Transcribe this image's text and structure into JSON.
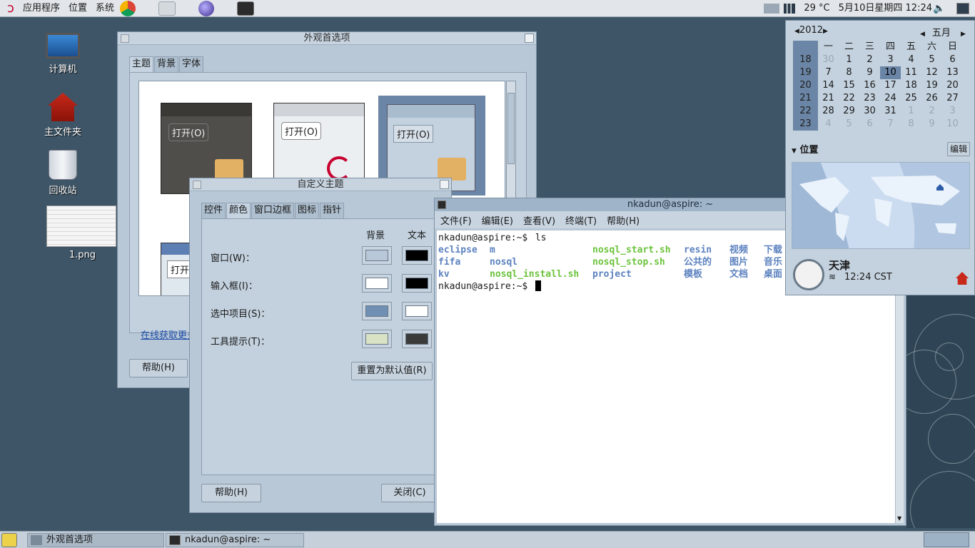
{
  "top_panel": {
    "menus": [
      "应用程序",
      "位置",
      "系统"
    ],
    "launchers": [
      "chrome-icon",
      "network-tool-icon",
      "browser-icon",
      "terminal-icon"
    ],
    "weather": "29 °C",
    "datetime": "5月10日星期四  12:24"
  },
  "desktop": {
    "icons": [
      {
        "name": "computer-icon",
        "label": "计算机"
      },
      {
        "name": "home-folder-icon",
        "label": "主文件夹"
      },
      {
        "name": "trash-icon",
        "label": "回收站"
      },
      {
        "name": "png-file-icon",
        "label": "1.png"
      }
    ]
  },
  "appearance": {
    "title": "外观首选项",
    "tabs": [
      "主题",
      "背景",
      "字体"
    ],
    "active_tab": "主题",
    "theme_open_label": "打开(O)",
    "online_link": "在线获取更多",
    "help_button": "帮助(H)"
  },
  "custom_theme": {
    "title": "自定义主题",
    "tabs": [
      "控件",
      "颜色",
      "窗口边框",
      "图标",
      "指针"
    ],
    "active_tab": "颜色",
    "col_bg": "背景",
    "col_text": "文本",
    "rows": [
      {
        "label": "窗口(W)：",
        "bg": "#b8c8d8",
        "text": "#000000"
      },
      {
        "label": "输入框(I)：",
        "bg": "#ffffff",
        "text": "#000000"
      },
      {
        "label": "选中项目(S)：",
        "bg": "#6f8fb3",
        "text": "#ffffff"
      },
      {
        "label": "工具提示(T)：",
        "bg": "#d9e2c4",
        "text": "#3a3a3a"
      }
    ],
    "reset_button": "重置为默认值(R)",
    "help_button": "帮助(H)",
    "close_button": "关闭(C)"
  },
  "terminal": {
    "title": "nkadun@aspire: ~",
    "menus": [
      "文件(F)",
      "编辑(E)",
      "查看(V)",
      "终端(T)",
      "帮助(H)"
    ],
    "prompt": "nkadun@aspire:~$",
    "command": " ls",
    "ls_rows": [
      [
        {
          "t": "eclipse",
          "c": "blue"
        },
        {
          "t": "m",
          "c": "blue"
        },
        {
          "t": "nosql_start.sh",
          "c": "green"
        },
        {
          "t": "resin",
          "c": "blue"
        },
        {
          "t": "视频",
          "c": "blue"
        },
        {
          "t": "下载",
          "c": "blue"
        }
      ],
      [
        {
          "t": "fifa",
          "c": "blue"
        },
        {
          "t": "nosql",
          "c": "blue"
        },
        {
          "t": "nosql_stop.sh",
          "c": "green"
        },
        {
          "t": "公共的",
          "c": "blue"
        },
        {
          "t": "图片",
          "c": "blue"
        },
        {
          "t": "音乐",
          "c": "blue"
        }
      ],
      [
        {
          "t": "kv",
          "c": "blue"
        },
        {
          "t": "nosql_install.sh",
          "c": "green"
        },
        {
          "t": "project",
          "c": "blue"
        },
        {
          "t": "模板",
          "c": "blue"
        },
        {
          "t": "文档",
          "c": "blue"
        },
        {
          "t": "桌面",
          "c": "blue"
        }
      ]
    ]
  },
  "calendar": {
    "year": "2012",
    "month": "五月",
    "weekday_headers": [
      "一",
      "二",
      "三",
      "四",
      "五",
      "六",
      "日"
    ],
    "weeks": [
      {
        "wk": "18",
        "days": [
          "30",
          "1",
          "2",
          "3",
          "4",
          "5",
          "6"
        ]
      },
      {
        "wk": "19",
        "days": [
          "7",
          "8",
          "9",
          "10",
          "11",
          "12",
          "13"
        ]
      },
      {
        "wk": "20",
        "days": [
          "14",
          "15",
          "16",
          "17",
          "18",
          "19",
          "20"
        ]
      },
      {
        "wk": "21",
        "days": [
          "21",
          "22",
          "23",
          "24",
          "25",
          "26",
          "27"
        ]
      },
      {
        "wk": "22",
        "days": [
          "28",
          "29",
          "30",
          "31",
          "1",
          "2",
          "3"
        ]
      },
      {
        "wk": "23",
        "days": [
          "4",
          "5",
          "6",
          "7",
          "8",
          "9",
          "10"
        ]
      }
    ],
    "today": "10",
    "locations_label": "位置",
    "edit_button": "编辑",
    "city": "天津",
    "city_time": "12:24 CST"
  },
  "taskbar": {
    "tasks": [
      "外观首选项",
      "nkadun@aspire: ~"
    ]
  }
}
